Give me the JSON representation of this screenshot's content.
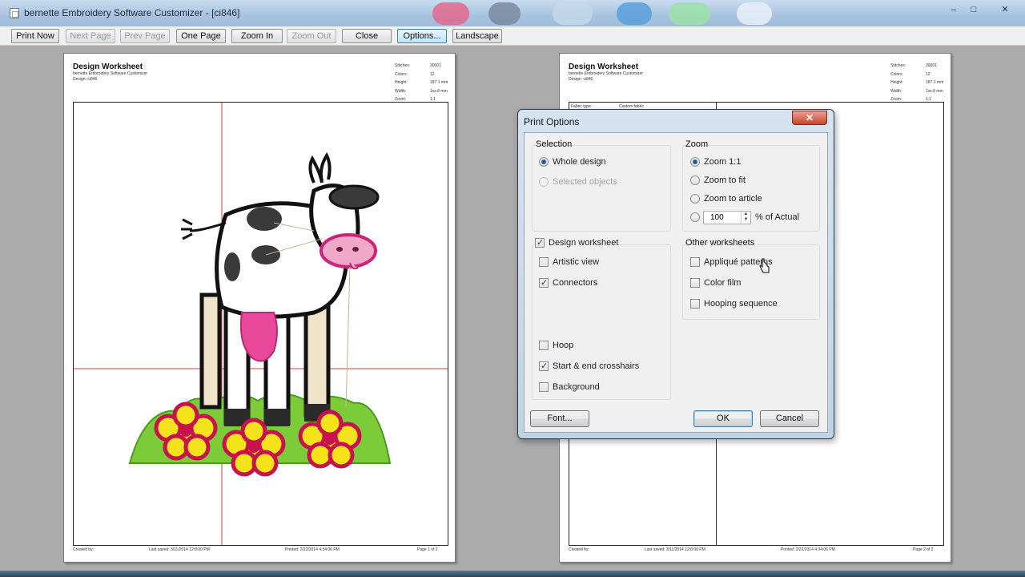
{
  "window": {
    "title": "bernette Embroidery Software Customizer - [ci846]",
    "min": "–",
    "max": "□",
    "close": "✕"
  },
  "toolbar": {
    "buttons": [
      {
        "label": "Print Now",
        "enabled": true
      },
      {
        "label": "Next Page",
        "enabled": false
      },
      {
        "label": "Prev Page",
        "enabled": false
      },
      {
        "label": "One Page",
        "enabled": true
      },
      {
        "label": "Zoom In",
        "enabled": true
      },
      {
        "label": "Zoom Out",
        "enabled": false
      },
      {
        "label": "Close",
        "enabled": true
      },
      {
        "label": "Options...",
        "enabled": true,
        "active": true
      },
      {
        "label": "Landscape",
        "enabled": true
      }
    ]
  },
  "pages": [
    {
      "title": "Design Worksheet",
      "sub1": "bernette Embroidery Software Customizer",
      "sub2": "Design: ci846",
      "info": [
        [
          "Stitches:",
          "30001"
        ],
        [
          "Colors:",
          "12"
        ],
        [
          "Height:",
          "187.1 mm"
        ],
        [
          "Width:",
          "1xx.8 mm"
        ],
        [
          "Zoom:",
          "1:1"
        ]
      ],
      "footer": {
        "created": "Created by:",
        "saved": "Last saved: 3/11/2014 12:8:00 PM",
        "printed": "Printed: 2/22/2014 4:34:06 PM",
        "page": "Page 1 of 2"
      }
    },
    {
      "title": "Design Worksheet",
      "sub1": "bernette Embroidery Software Customizer",
      "sub2": "Design: ci846",
      "info": [
        [
          "Stitches:",
          "30001"
        ],
        [
          "Colors:",
          "12"
        ],
        [
          "Height:",
          "187.1 mm"
        ],
        [
          "Width:",
          "1xx.8 mm"
        ],
        [
          "Zoom:",
          "1:1"
        ]
      ],
      "table_header": [
        "Fabric type:",
        "Custom fabric"
      ],
      "footer": {
        "created": "Created by:",
        "saved": "Last saved: 3/11/2014 12:8:00 PM",
        "printed": "Printed: 2/22/2014 4:34:06 PM",
        "page": "Page 2 of 2"
      }
    }
  ],
  "dialog": {
    "title": "Print Options",
    "close": "✕",
    "selection": {
      "title": "Selection",
      "options": [
        {
          "label": "Whole design",
          "checked": true,
          "enabled": true
        },
        {
          "label": "Selected objects",
          "checked": false,
          "enabled": false
        }
      ]
    },
    "zoom": {
      "title": "Zoom",
      "options": [
        {
          "label": "Zoom 1:1",
          "checked": true
        },
        {
          "label": "Zoom to fit",
          "checked": false
        },
        {
          "label": "Zoom to article",
          "checked": false
        }
      ],
      "percent_value": "100",
      "percent_label": "% of Actual"
    },
    "design_worksheet": {
      "label": "Design worksheet",
      "checked": true,
      "options": [
        {
          "label": "Artistic view",
          "checked": false
        },
        {
          "label": "Connectors",
          "checked": true
        },
        {
          "label": "Hoop",
          "checked": false
        },
        {
          "label": "Start & end crosshairs",
          "checked": true
        },
        {
          "label": "Background",
          "checked": false
        }
      ]
    },
    "other": {
      "title": "Other worksheets",
      "options": [
        {
          "label": "Appliqué patterns",
          "checked": false
        },
        {
          "label": "Color film",
          "checked": false
        },
        {
          "label": "Hooping sequence",
          "checked": false
        }
      ]
    },
    "buttons": {
      "font": "Font...",
      "ok": "OK",
      "cancel": "Cancel"
    }
  },
  "colors": {
    "accent": "#3c7fb1",
    "crosshair": "#e23b3b",
    "pink": "#e8479a",
    "flower": "#c8124e",
    "yellow": "#f4e21a",
    "grass": "#7ccc3a"
  }
}
